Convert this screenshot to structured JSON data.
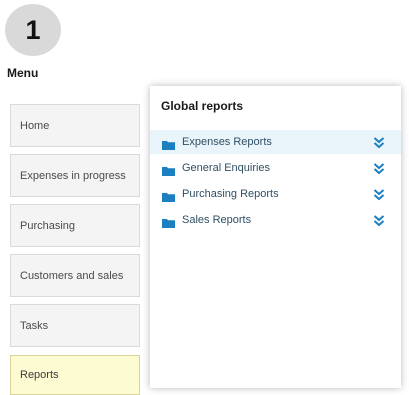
{
  "step_number": "1",
  "menu": {
    "title": "Menu",
    "items": [
      {
        "label": "Home"
      },
      {
        "label": "Expenses in progress"
      },
      {
        "label": "Purchasing"
      },
      {
        "label": "Customers and sales"
      },
      {
        "label": "Tasks"
      },
      {
        "label": "Reports",
        "active": true
      }
    ]
  },
  "panel": {
    "title": "Global reports",
    "reports": [
      {
        "label": "Expenses Reports",
        "highlighted": true,
        "icon": "folder-icon",
        "action_icon": "double-chevron-down-icon"
      },
      {
        "label": "General Enquiries",
        "icon": "folder-icon",
        "action_icon": "double-chevron-down-icon"
      },
      {
        "label": "Purchasing Reports",
        "icon": "folder-icon",
        "action_icon": "double-chevron-down-icon"
      },
      {
        "label": "Sales Reports",
        "icon": "folder-icon",
        "action_icon": "double-chevron-down-icon"
      }
    ]
  },
  "colors": {
    "accent": "#1b7fc0",
    "active_item_bg": "#fdfbd2",
    "highlight_row_bg": "#eaf4fb"
  }
}
